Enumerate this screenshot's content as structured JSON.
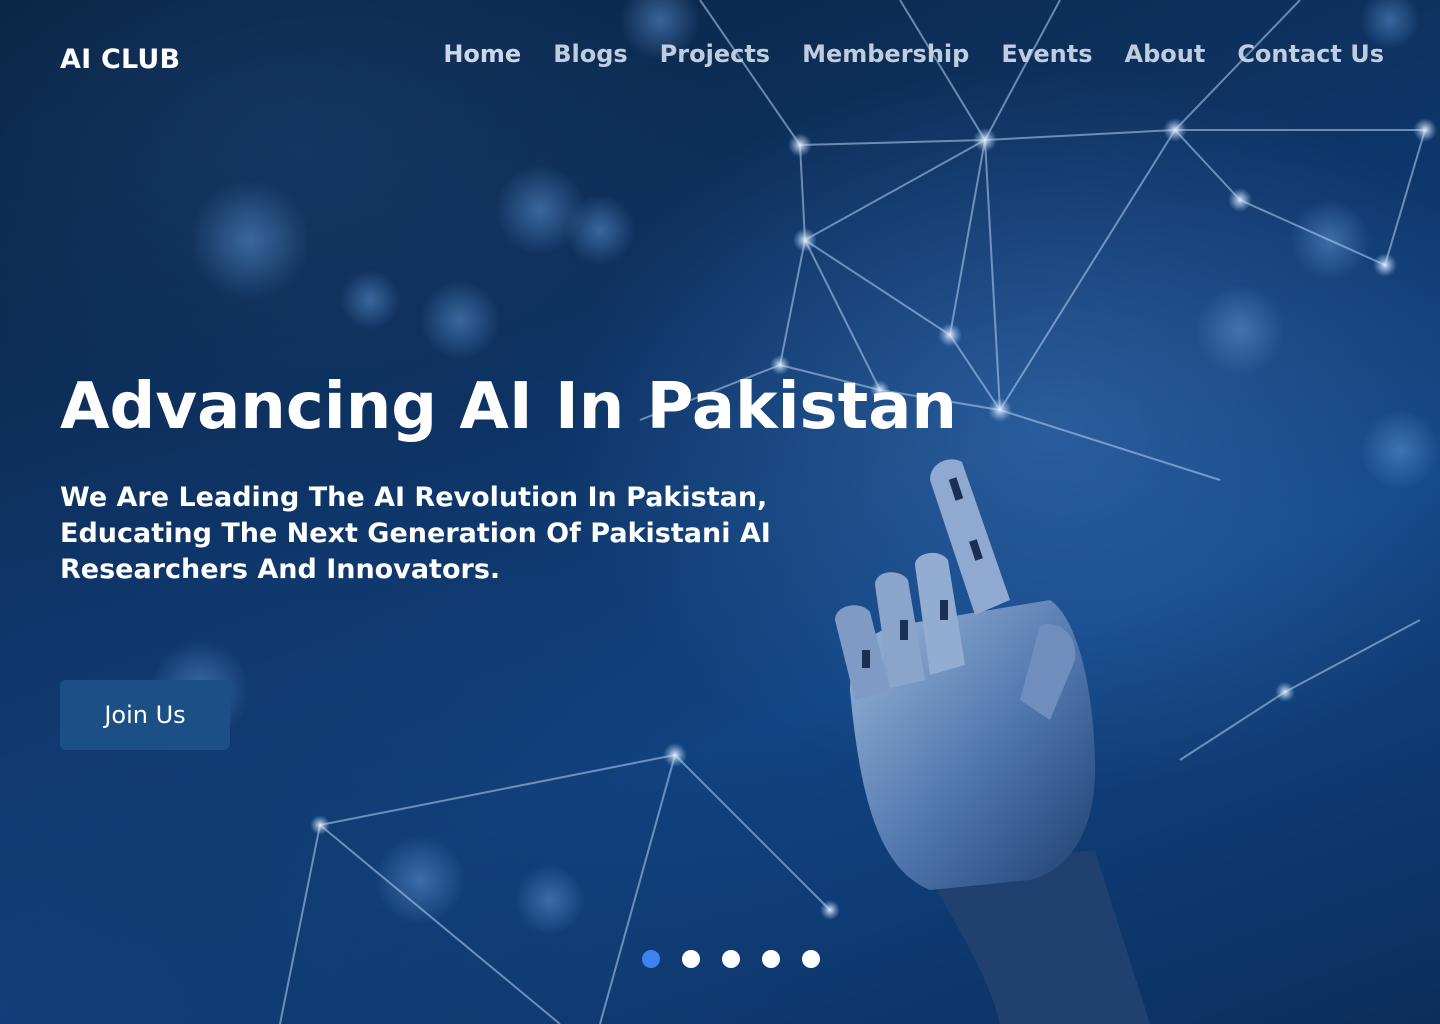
{
  "brand": {
    "name": "AI CLUB"
  },
  "nav": {
    "items": [
      {
        "label": "Home"
      },
      {
        "label": "Blogs"
      },
      {
        "label": "Projects"
      },
      {
        "label": "Membership"
      },
      {
        "label": "Events"
      },
      {
        "label": "About"
      },
      {
        "label": "Contact Us"
      }
    ]
  },
  "hero": {
    "headline": "Advancing AI In Pakistan",
    "subheading": "We Are Leading The AI Revolution In Pakistan, Educating The Next Generation Of Pakistani AI Researchers And Innovators.",
    "cta_label": "Join Us",
    "background_image": "robotic-hand-neural-network"
  },
  "carousel": {
    "slide_count": 5,
    "active_index": 0
  },
  "colors": {
    "background_navy": "#0e3466",
    "button": "#1b4f85",
    "dot_active": "#3f82f0",
    "dot_inactive": "#ffffff",
    "nav_text": "#c9d6e6",
    "text": "#ffffff"
  }
}
